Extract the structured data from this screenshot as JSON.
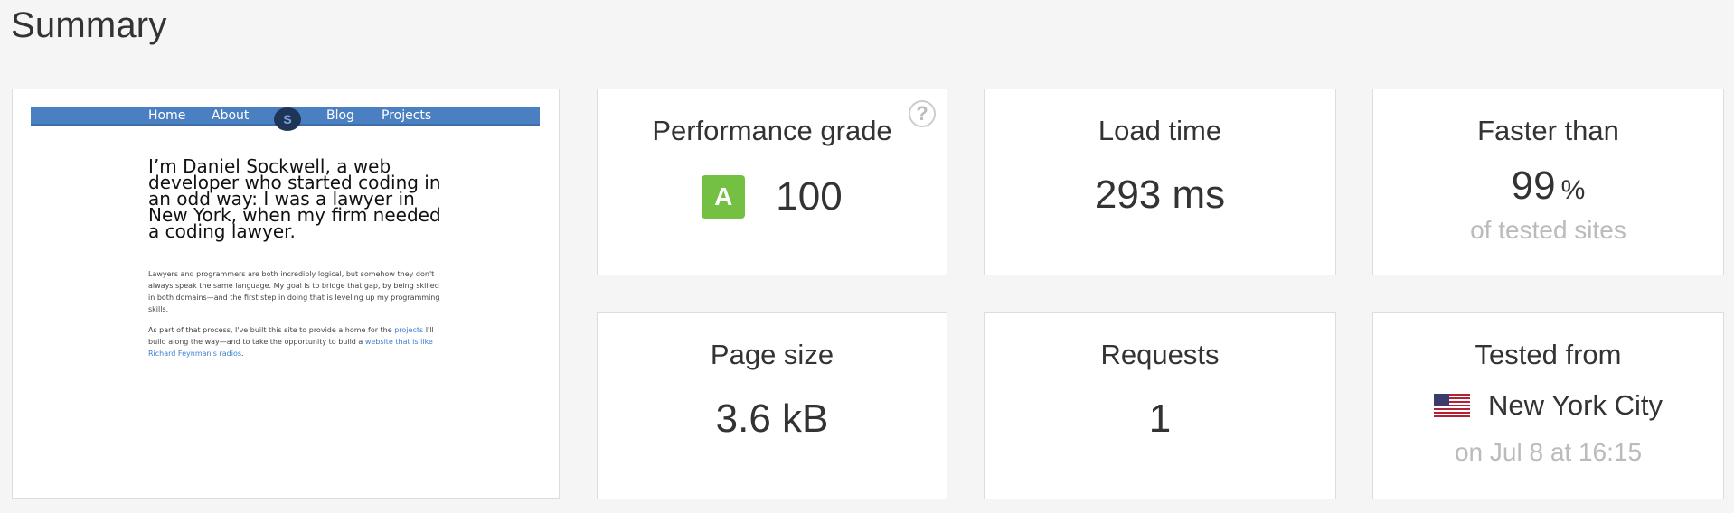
{
  "page": {
    "title": "Summary"
  },
  "screenshot": {
    "nav": [
      "Home",
      "About",
      "Blog",
      "Projects"
    ],
    "logo_text": "S",
    "heading": "I’m Daniel Sockwell, a web developer who started coding in an odd way: I was a lawyer in New York, when my firm needed a coding lawyer.",
    "para1": "Lawyers and programmers are both incredibly logical, but somehow they don't always speak the same language. My goal is to bridge that gap, by being skilled in both domains—and the first step in doing that is leveling up my programming skills.",
    "para2_before": "As part of that process, I've built this site to provide a home for the ",
    "para2_link1": "projects",
    "para2_mid": " I'll build along the way—and to take the opportunity to build a ",
    "para2_link2": "website that is like Richard Feynman's radios",
    "para2_after": "."
  },
  "performance": {
    "label": "Performance grade",
    "grade": "A",
    "score": "100",
    "help": "?"
  },
  "load_time": {
    "label": "Load time",
    "value": "293 ms"
  },
  "faster_than": {
    "label": "Faster than",
    "value": "99",
    "unit": "%",
    "sub": "of tested sites"
  },
  "page_size": {
    "label": "Page size",
    "value": "3.6 kB"
  },
  "requests": {
    "label": "Requests",
    "value": "1"
  },
  "tested_from": {
    "label": "Tested from",
    "location": "New York City",
    "flag": "us-flag-icon",
    "date": "on Jul 8 at 16:15"
  },
  "colors": {
    "grade_green": "#74c043",
    "nav_blue": "#4a7fc1",
    "muted": "#bbbbbb"
  }
}
